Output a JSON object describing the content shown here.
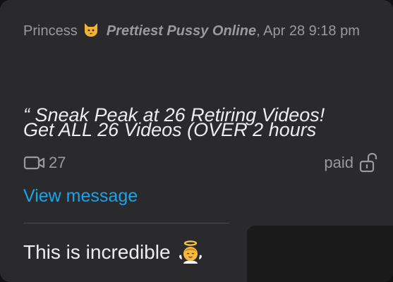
{
  "quote": {
    "author": "Princess",
    "channel": "Prettiest Pussy Online",
    "timestamp": ", Apr 28 9:18 pm",
    "line1": "“ Sneak Peak at 26 Retiring Videos!",
    "line2": "Get ALL 26 Videos (OVER 2 hours",
    "badge_icon": "cat-face-icon"
  },
  "media": {
    "video_count": "27",
    "icon": "video-camera-icon"
  },
  "paid": {
    "label": "paid",
    "icon": "unlock-icon"
  },
  "view_message": "View message",
  "reply": {
    "text": "This is incredible",
    "emoji_icon": "baby-angel-icon"
  },
  "colors": {
    "bubble_bg": "#2a2a2c",
    "link": "#1aa3e8",
    "muted_text": "#9a9a9e",
    "primary_text": "#ededf0"
  }
}
